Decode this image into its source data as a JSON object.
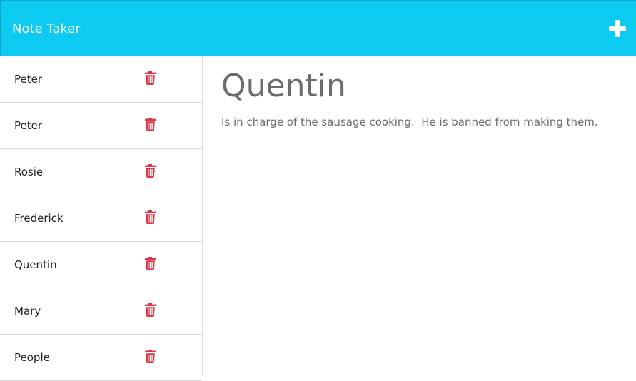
{
  "navbar": {
    "brand": "Note Taker",
    "new_note_icon": "plus-icon",
    "background": "#0dcaf0"
  },
  "sidebar": {
    "delete_icon": "trash-icon",
    "delete_color": "#dc3545",
    "notes": [
      {
        "title": "Peter"
      },
      {
        "title": "Peter"
      },
      {
        "title": "Rosie"
      },
      {
        "title": "Frederick"
      },
      {
        "title": "Quentin"
      },
      {
        "title": "Mary"
      },
      {
        "title": "People"
      }
    ]
  },
  "active_note": {
    "title": "Quentin",
    "text": "Is in charge of the sausage cooking.  He is banned from making them."
  }
}
